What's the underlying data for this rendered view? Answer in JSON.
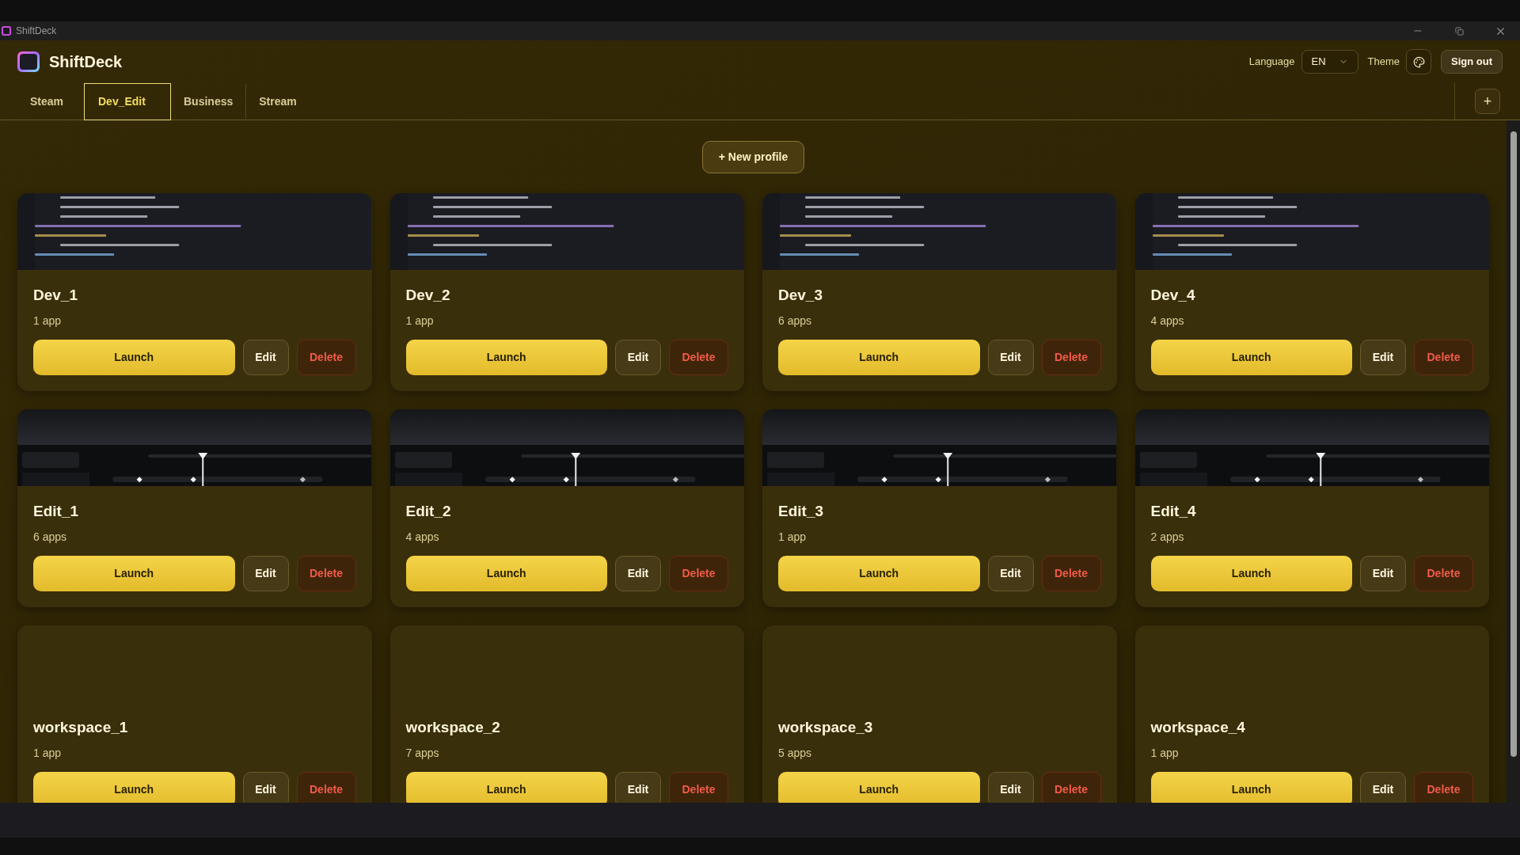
{
  "window": {
    "title": "ShiftDeck"
  },
  "app": {
    "name": "ShiftDeck"
  },
  "header": {
    "language_label": "Language",
    "language_value": "EN",
    "theme_label": "Theme",
    "sign_out": "Sign out"
  },
  "tabs": [
    {
      "label": "Steam",
      "selected": false
    },
    {
      "label": "Dev_Edit",
      "selected": true
    },
    {
      "label": "Business",
      "selected": false
    },
    {
      "label": "Stream",
      "selected": false
    }
  ],
  "add_tab": "+",
  "new_profile": "+ New profile",
  "profiles": [
    {
      "name": "Dev_1",
      "count": "1 app",
      "launch": "Launch",
      "edit": "Edit",
      "delete": "Delete"
    },
    {
      "name": "Dev_2",
      "count": "1 app",
      "launch": "Launch",
      "edit": "Edit",
      "delete": "Delete"
    },
    {
      "name": "Dev_3",
      "count": "6 apps",
      "launch": "Launch",
      "edit": "Edit",
      "delete": "Delete"
    },
    {
      "name": "Dev_4",
      "count": "4 apps",
      "launch": "Launch",
      "edit": "Edit",
      "delete": "Delete"
    },
    {
      "name": "Edit_1",
      "count": "6 apps",
      "launch": "Launch",
      "edit": "Edit",
      "delete": "Delete"
    },
    {
      "name": "Edit_2",
      "count": "4 apps",
      "launch": "Launch",
      "edit": "Edit",
      "delete": "Delete"
    },
    {
      "name": "Edit_3",
      "count": "1 app",
      "launch": "Launch",
      "edit": "Edit",
      "delete": "Delete"
    },
    {
      "name": "Edit_4",
      "count": "2 apps",
      "launch": "Launch",
      "edit": "Edit",
      "delete": "Delete"
    },
    {
      "name": "workspace_1",
      "count": "1 app",
      "launch": "Launch",
      "edit": "Edit",
      "delete": "Delete"
    },
    {
      "name": "workspace_2",
      "count": "7 apps",
      "launch": "Launch",
      "edit": "Edit",
      "delete": "Delete"
    },
    {
      "name": "workspace_3",
      "count": "5 apps",
      "launch": "Launch",
      "edit": "Edit",
      "delete": "Delete"
    },
    {
      "name": "workspace_4",
      "count": "1 app",
      "launch": "Launch",
      "edit": "Edit",
      "delete": "Delete"
    }
  ]
}
